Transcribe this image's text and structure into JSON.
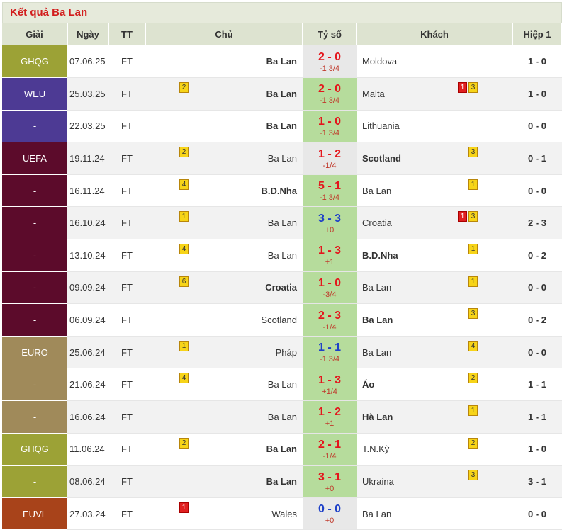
{
  "title": "Kết quả Ba Lan",
  "headers": [
    "Giải",
    "Ngày",
    "TT",
    "Chủ",
    "Tỷ số",
    "Khách",
    "Hiệp 1"
  ],
  "rows": [
    {
      "league": "GHQG",
      "lc": "#9ca236",
      "date": "07.06.25",
      "status": "FT",
      "home": "Ba Lan",
      "hb": true,
      "hcards": [],
      "score": "2 - 0",
      "sc": "red",
      "hc": "-1 3/4",
      "win": false,
      "away": "Moldova",
      "ab": false,
      "acards": [],
      "ht": "1 - 0"
    },
    {
      "league": "WEU",
      "lc": "#4d3a94",
      "date": "25.03.25",
      "status": "FT",
      "home": "Ba Lan",
      "hb": true,
      "hcards": [
        {
          "t": "y",
          "v": "2"
        }
      ],
      "score": "2 - 0",
      "sc": "red",
      "hc": "-1 3/4",
      "win": true,
      "away": "Malta",
      "ab": false,
      "acards": [
        {
          "t": "r",
          "v": "1"
        },
        {
          "t": "y",
          "v": "3"
        }
      ],
      "ht": "1 - 0"
    },
    {
      "league": "-",
      "lc": "#4d3a94",
      "date": "22.03.25",
      "status": "FT",
      "home": "Ba Lan",
      "hb": true,
      "hcards": [],
      "score": "1 - 0",
      "sc": "red",
      "hc": "-1 3/4",
      "win": true,
      "away": "Lithuania",
      "ab": false,
      "acards": [],
      "ht": "0 - 0"
    },
    {
      "league": "UEFA",
      "lc": "#5c0b2b",
      "date": "19.11.24",
      "status": "FT",
      "home": "Ba Lan",
      "hb": false,
      "hcards": [
        {
          "t": "y",
          "v": "2"
        }
      ],
      "score": "1 - 2",
      "sc": "red",
      "hc": "-1/4",
      "win": false,
      "away": "Scotland",
      "ab": true,
      "acards": [
        {
          "t": "y",
          "v": "3"
        }
      ],
      "ht": "0 - 1"
    },
    {
      "league": "-",
      "lc": "#5c0b2b",
      "date": "16.11.24",
      "status": "FT",
      "home": "B.D.Nha",
      "hb": true,
      "hcards": [
        {
          "t": "y",
          "v": "4"
        }
      ],
      "score": "5 - 1",
      "sc": "red",
      "hc": "-1 3/4",
      "win": true,
      "away": "Ba Lan",
      "ab": false,
      "acards": [
        {
          "t": "y",
          "v": "1"
        }
      ],
      "ht": "0 - 0"
    },
    {
      "league": "-",
      "lc": "#5c0b2b",
      "date": "16.10.24",
      "status": "FT",
      "home": "Ba Lan",
      "hb": false,
      "hcards": [
        {
          "t": "y",
          "v": "1"
        }
      ],
      "score": "3 - 3",
      "sc": "blue",
      "hc": "+0",
      "win": true,
      "away": "Croatia",
      "ab": false,
      "acards": [
        {
          "t": "r",
          "v": "1"
        },
        {
          "t": "y",
          "v": "3"
        }
      ],
      "ht": "2 - 3"
    },
    {
      "league": "-",
      "lc": "#5c0b2b",
      "date": "13.10.24",
      "status": "FT",
      "home": "Ba Lan",
      "hb": false,
      "hcards": [
        {
          "t": "y",
          "v": "4"
        }
      ],
      "score": "1 - 3",
      "sc": "red",
      "hc": "+1",
      "win": true,
      "away": "B.D.Nha",
      "ab": true,
      "acards": [
        {
          "t": "y",
          "v": "1"
        }
      ],
      "ht": "0 - 2"
    },
    {
      "league": "-",
      "lc": "#5c0b2b",
      "date": "09.09.24",
      "status": "FT",
      "home": "Croatia",
      "hb": true,
      "hcards": [
        {
          "t": "y",
          "v": "6"
        }
      ],
      "score": "1 - 0",
      "sc": "red",
      "hc": "-3/4",
      "win": true,
      "away": "Ba Lan",
      "ab": false,
      "acards": [
        {
          "t": "y",
          "v": "1"
        }
      ],
      "ht": "0 - 0"
    },
    {
      "league": "-",
      "lc": "#5c0b2b",
      "date": "06.09.24",
      "status": "FT",
      "home": "Scotland",
      "hb": false,
      "hcards": [],
      "score": "2 - 3",
      "sc": "red",
      "hc": "-1/4",
      "win": true,
      "away": "Ba Lan",
      "ab": true,
      "acards": [
        {
          "t": "y",
          "v": "3"
        }
      ],
      "ht": "0 - 2"
    },
    {
      "league": "EURO",
      "lc": "#a08a5a",
      "date": "25.06.24",
      "status": "FT",
      "home": "Pháp",
      "hb": false,
      "hcards": [
        {
          "t": "y",
          "v": "1"
        }
      ],
      "score": "1 - 1",
      "sc": "blue",
      "hc": "-1 3/4",
      "win": true,
      "away": "Ba Lan",
      "ab": false,
      "acards": [
        {
          "t": "y",
          "v": "4"
        }
      ],
      "ht": "0 - 0"
    },
    {
      "league": "-",
      "lc": "#a08a5a",
      "date": "21.06.24",
      "status": "FT",
      "home": "Ba Lan",
      "hb": false,
      "hcards": [
        {
          "t": "y",
          "v": "4"
        }
      ],
      "score": "1 - 3",
      "sc": "red",
      "hc": "+1/4",
      "win": true,
      "away": "Áo",
      "ab": true,
      "acards": [
        {
          "t": "y",
          "v": "2"
        }
      ],
      "ht": "1 - 1"
    },
    {
      "league": "-",
      "lc": "#a08a5a",
      "date": "16.06.24",
      "status": "FT",
      "home": "Ba Lan",
      "hb": false,
      "hcards": [],
      "score": "1 - 2",
      "sc": "red",
      "hc": "+1",
      "win": true,
      "away": "Hà Lan",
      "ab": true,
      "acards": [
        {
          "t": "y",
          "v": "1"
        }
      ],
      "ht": "1 - 1"
    },
    {
      "league": "GHQG",
      "lc": "#9ca236",
      "date": "11.06.24",
      "status": "FT",
      "home": "Ba Lan",
      "hb": true,
      "hcards": [
        {
          "t": "y",
          "v": "2"
        }
      ],
      "score": "2 - 1",
      "sc": "red",
      "hc": "-1/4",
      "win": true,
      "away": "T.N.Kỳ",
      "ab": false,
      "acards": [
        {
          "t": "y",
          "v": "2"
        }
      ],
      "ht": "1 - 0"
    },
    {
      "league": "-",
      "lc": "#9ca236",
      "date": "08.06.24",
      "status": "FT",
      "home": "Ba Lan",
      "hb": true,
      "hcards": [],
      "score": "3 - 1",
      "sc": "red",
      "hc": "+0",
      "win": true,
      "away": "Ukraina",
      "ab": false,
      "acards": [
        {
          "t": "y",
          "v": "3"
        }
      ],
      "ht": "3 - 1"
    },
    {
      "league": "EUVL",
      "lc": "#a8431a",
      "date": "27.03.24",
      "status": "FT",
      "home": "Wales",
      "hb": false,
      "hcards": [
        {
          "t": "r",
          "v": "1"
        }
      ],
      "score": "0 - 0",
      "sc": "blue",
      "hc": "+0",
      "win": false,
      "away": "Ba Lan",
      "ab": false,
      "acards": [],
      "ht": "0 - 0"
    }
  ]
}
